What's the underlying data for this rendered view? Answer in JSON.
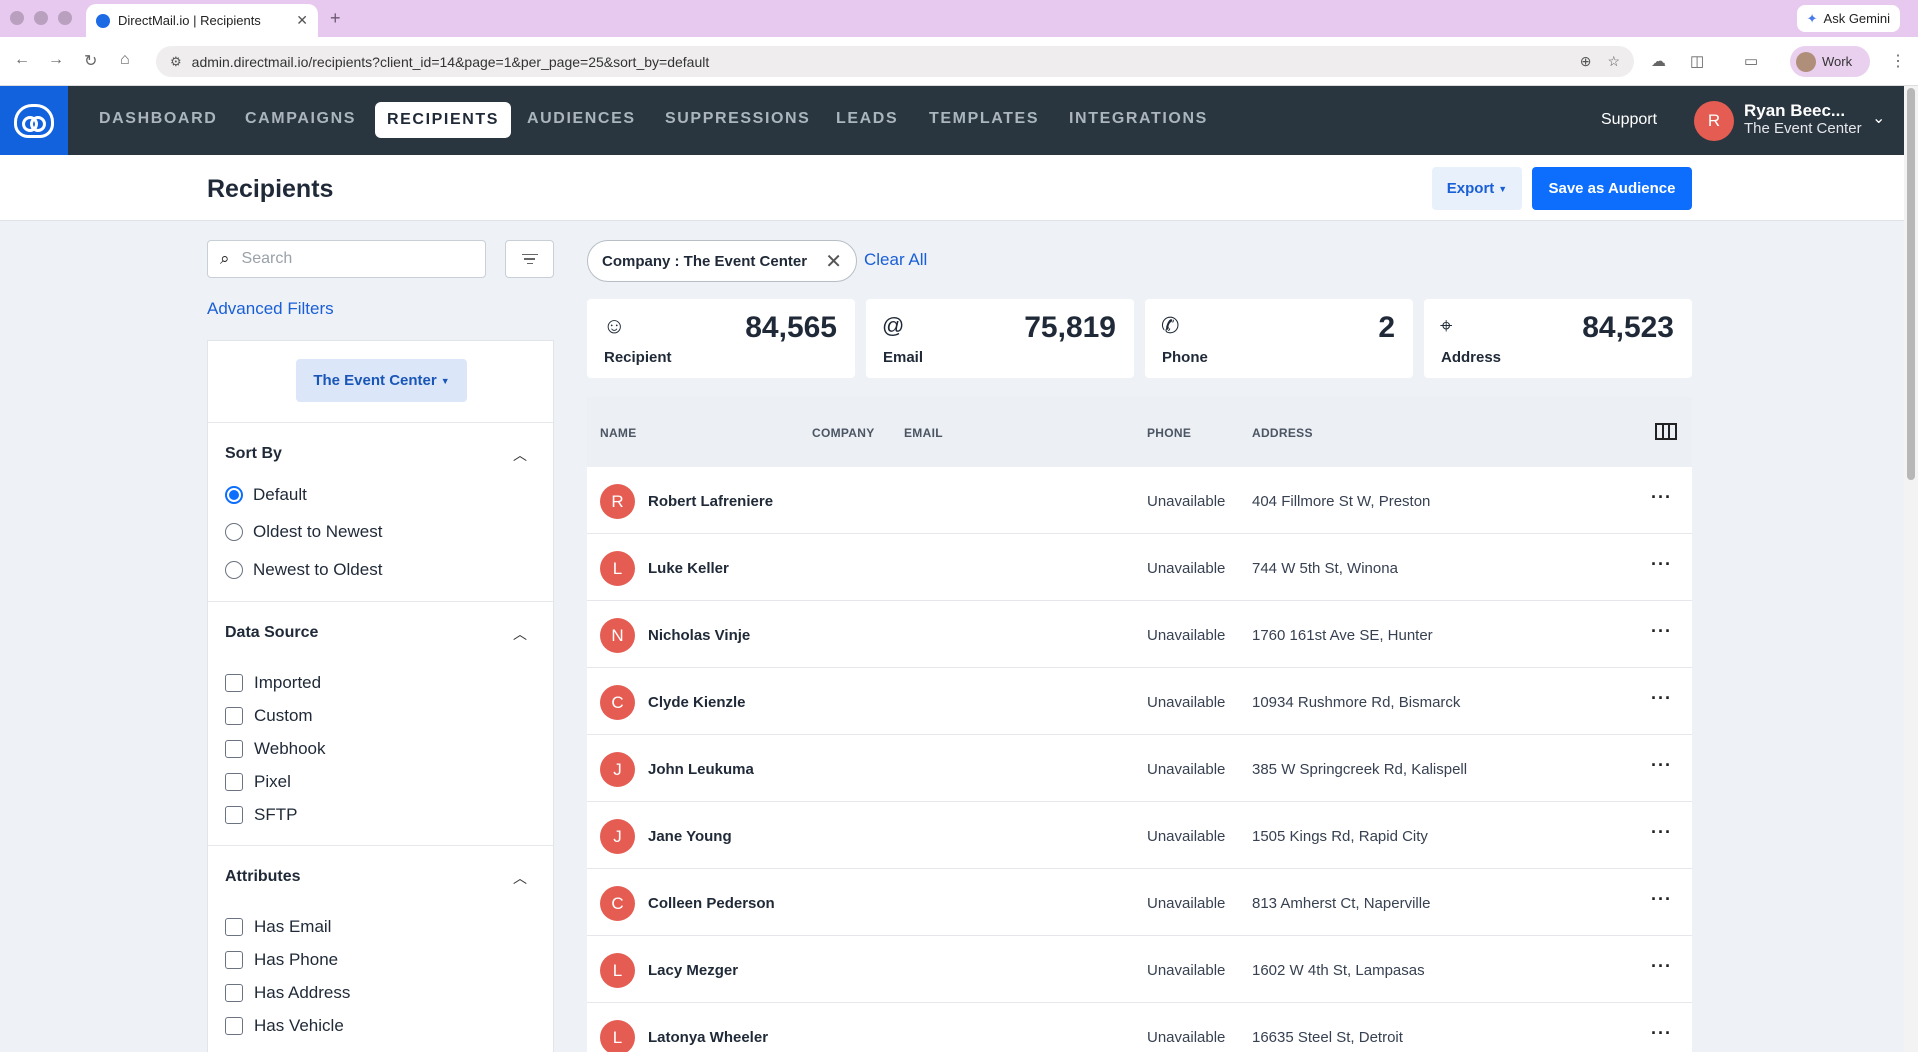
{
  "browser": {
    "tab_title": "DirectMail.io | Recipients",
    "url": "admin.directmail.io/recipients?client_id=14&page=1&per_page=25&sort_by=default",
    "gemini_label": "Ask Gemini",
    "profile_label": "Work"
  },
  "nav": {
    "items": [
      "DASHBOARD",
      "CAMPAIGNS",
      "RECIPIENTS",
      "AUDIENCES",
      "SUPPRESSIONS",
      "LEADS",
      "TEMPLATES",
      "INTEGRATIONS"
    ],
    "active": "RECIPIENTS",
    "support": "Support",
    "user": {
      "initial": "R",
      "name": "Ryan Beec...",
      "company": "The Event Center"
    }
  },
  "header": {
    "title": "Recipients",
    "export_label": "Export",
    "save_label": "Save as Audience"
  },
  "filters": {
    "search_placeholder": "Search",
    "advanced_label": "Advanced Filters",
    "client_label": "The Event Center",
    "sort_by": {
      "title": "Sort By",
      "options": [
        "Default",
        "Oldest to Newest",
        "Newest to Oldest"
      ],
      "selected": "Default"
    },
    "data_source": {
      "title": "Data Source",
      "options": [
        "Imported",
        "Custom",
        "Webhook",
        "Pixel",
        "SFTP"
      ]
    },
    "attributes": {
      "title": "Attributes",
      "options": [
        "Has Email",
        "Has Phone",
        "Has Address",
        "Has Vehicle"
      ]
    }
  },
  "active_filter": {
    "label": "Company : The Event Center",
    "clear_label": "Clear All"
  },
  "stats": [
    {
      "label": "Recipient",
      "value": "84,565",
      "icon": "user-circle-icon"
    },
    {
      "label": "Email",
      "value": "75,819",
      "icon": "at-icon"
    },
    {
      "label": "Phone",
      "value": "2",
      "icon": "phone-icon"
    },
    {
      "label": "Address",
      "value": "84,523",
      "icon": "map-pin-icon"
    }
  ],
  "table": {
    "headers": {
      "name": "NAME",
      "company": "COMPANY",
      "email": "EMAIL",
      "phone": "PHONE",
      "address": "ADDRESS"
    },
    "rows": [
      {
        "initial": "R",
        "name": "Robert Lafreniere",
        "phone": "Unavailable",
        "address": "404 Fillmore St W, Preston"
      },
      {
        "initial": "L",
        "name": "Luke Keller",
        "phone": "Unavailable",
        "address": "744 W 5th St, Winona"
      },
      {
        "initial": "N",
        "name": "Nicholas Vinje",
        "phone": "Unavailable",
        "address": "1760 161st Ave SE, Hunter"
      },
      {
        "initial": "C",
        "name": "Clyde Kienzle",
        "phone": "Unavailable",
        "address": "10934 Rushmore Rd, Bismarck"
      },
      {
        "initial": "J",
        "name": "John Leukuma",
        "phone": "Unavailable",
        "address": "385 W Springcreek Rd, Kalispell"
      },
      {
        "initial": "J",
        "name": "Jane Young",
        "phone": "Unavailable",
        "address": "1505 Kings Rd, Rapid City"
      },
      {
        "initial": "C",
        "name": "Colleen Pederson",
        "phone": "Unavailable",
        "address": "813 Amherst Ct, Naperville"
      },
      {
        "initial": "L",
        "name": "Lacy Mezger",
        "phone": "Unavailable",
        "address": "1602 W 4th St, Lampasas"
      },
      {
        "initial": "L",
        "name": "Latonya Wheeler",
        "phone": "Unavailable",
        "address": "16635 Steel St, Detroit"
      }
    ]
  },
  "colors": {
    "nav_bg": "#2a363f",
    "brand_blue": "#0d6efd",
    "avatar_red": "#e55d52"
  }
}
